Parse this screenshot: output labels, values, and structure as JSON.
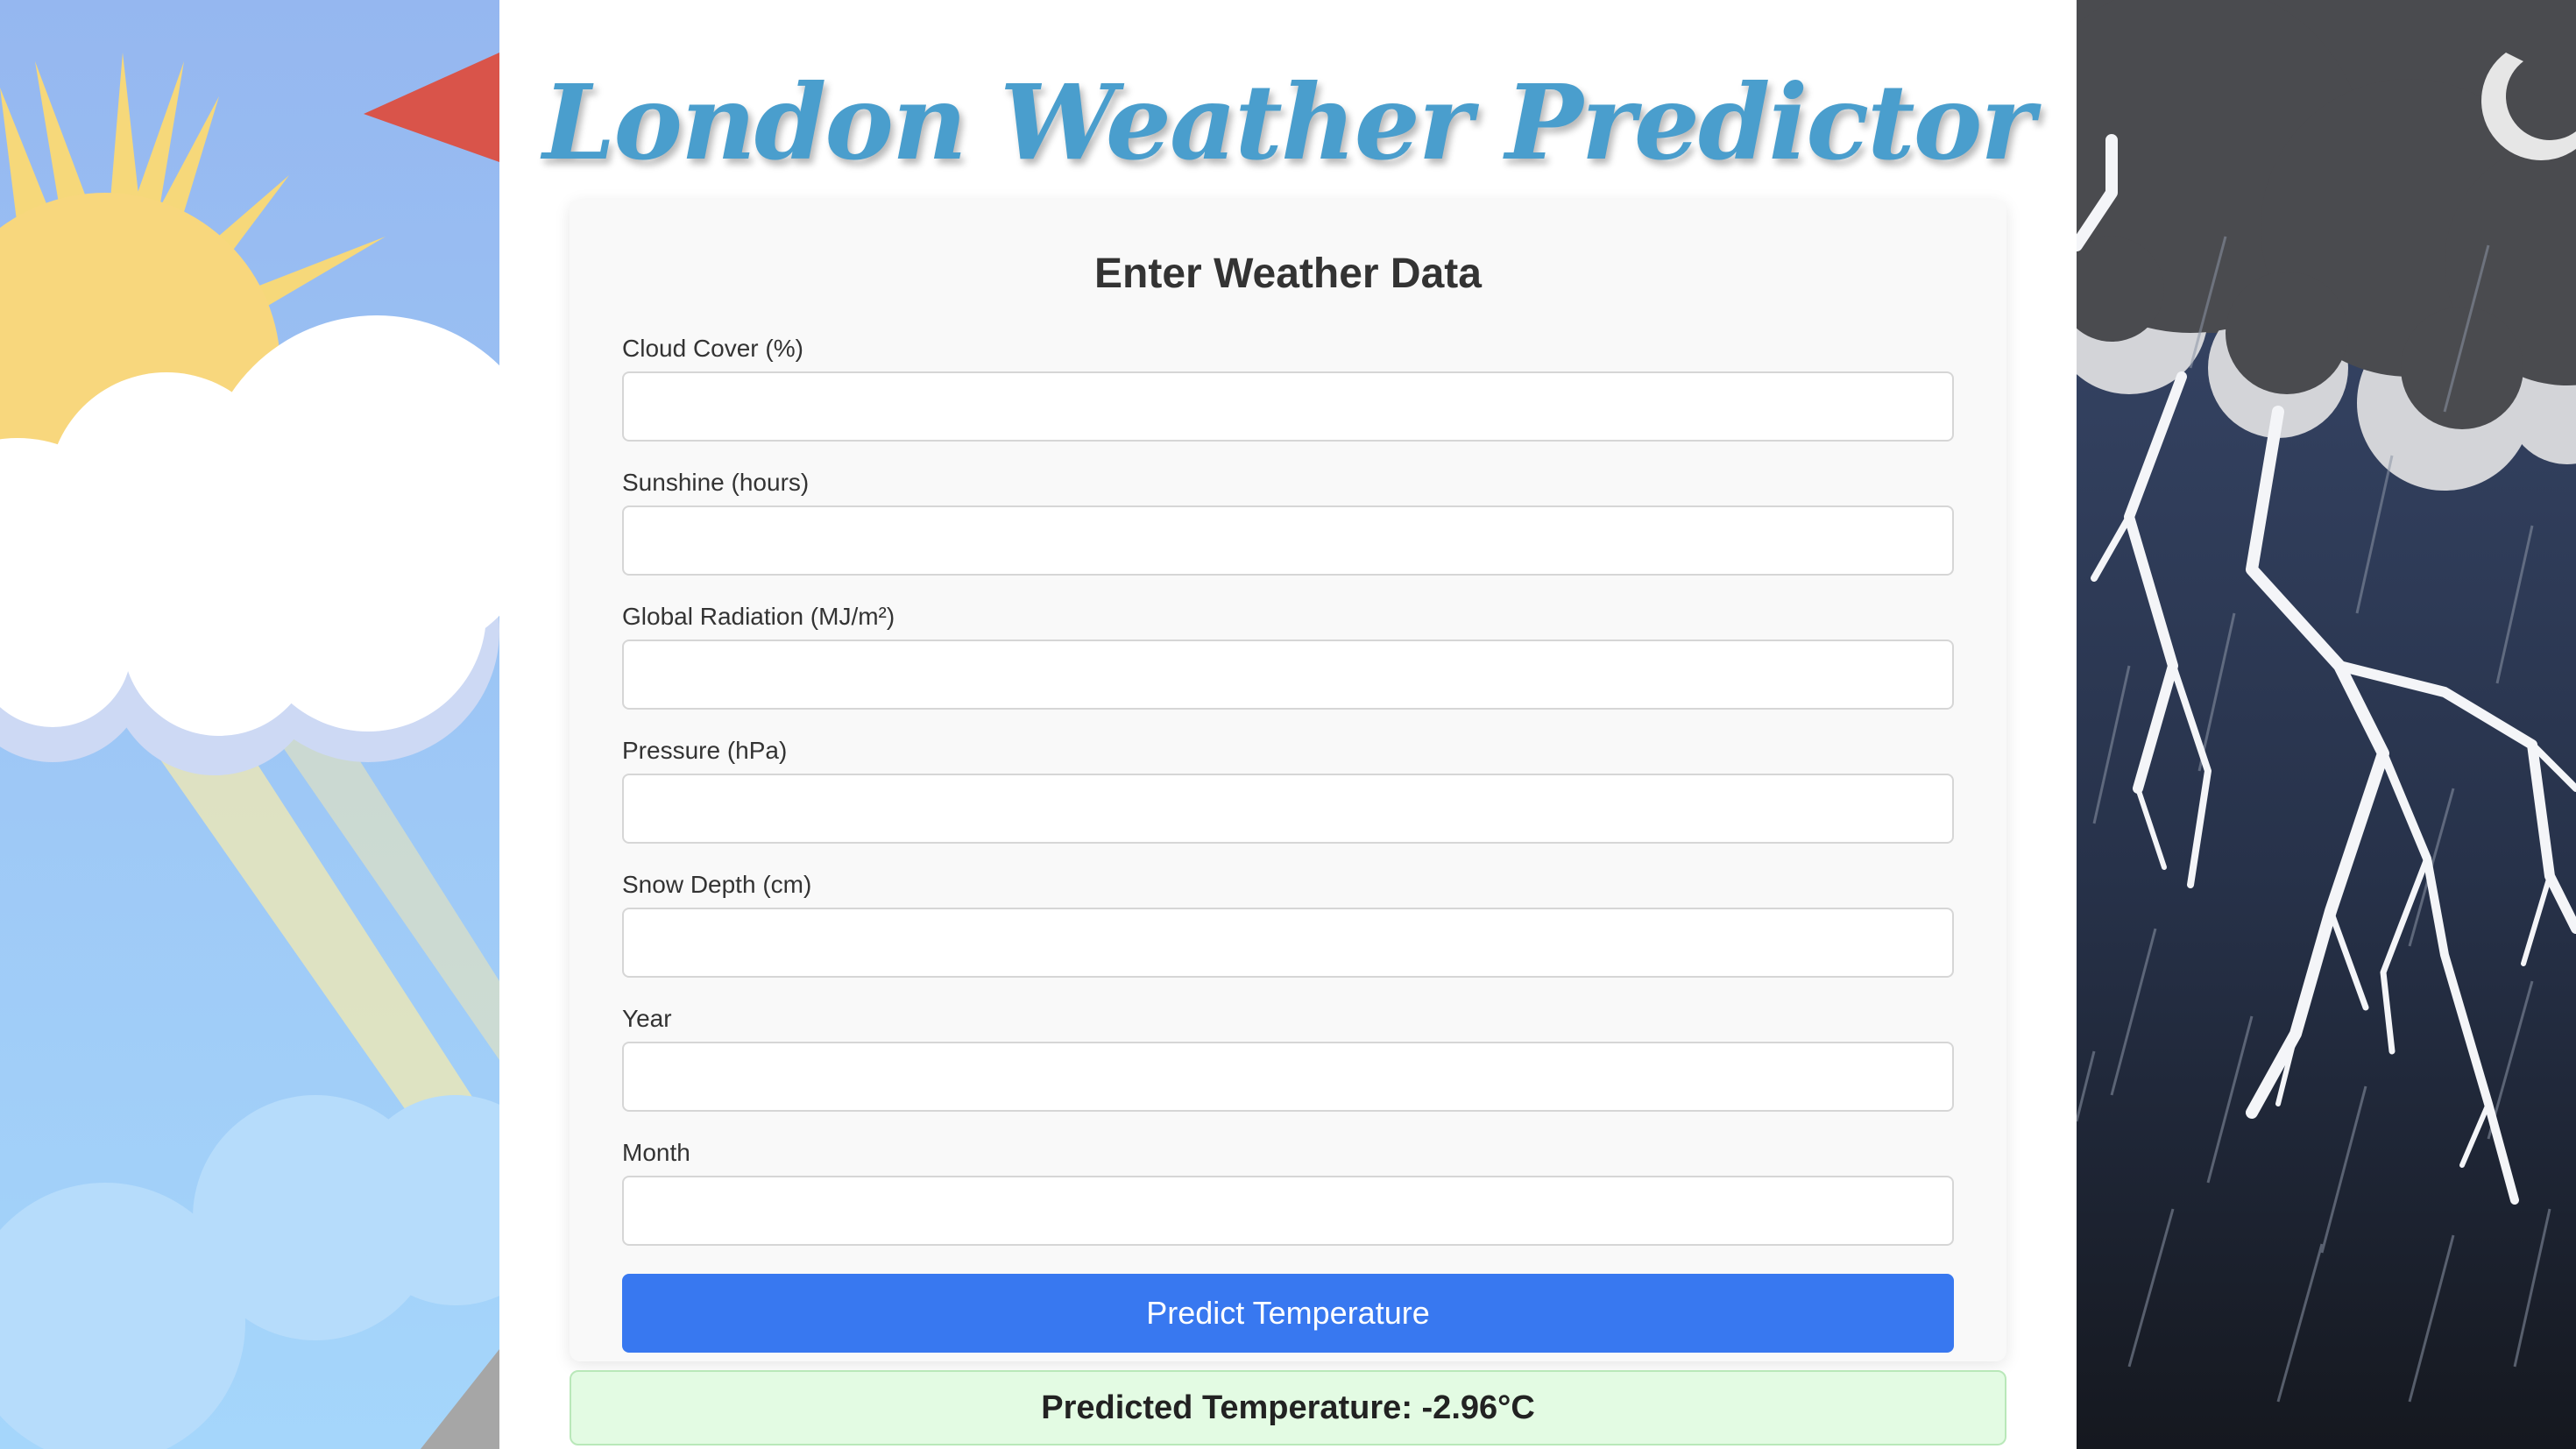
{
  "app": {
    "title": "London Weather Predictor"
  },
  "form": {
    "heading": "Enter Weather Data",
    "fields": [
      {
        "label": "Cloud Cover (%)",
        "value": "",
        "placeholder": ""
      },
      {
        "label": "Sunshine (hours)",
        "value": "",
        "placeholder": ""
      },
      {
        "label": "Global Radiation (MJ/m²)",
        "value": "",
        "placeholder": ""
      },
      {
        "label": "Pressure (hPa)",
        "value": "",
        "placeholder": ""
      },
      {
        "label": "Snow Depth (cm)",
        "value": "",
        "placeholder": ""
      },
      {
        "label": "Year",
        "value": "",
        "placeholder": ""
      },
      {
        "label": "Month",
        "value": "",
        "placeholder": ""
      }
    ],
    "submit_label": "Predict Temperature"
  },
  "result": {
    "text": "Predicted Temperature: -2.96°C"
  },
  "colors": {
    "title": "#4a9ecd",
    "button": "#3878f0",
    "result_bg": "#e3fbe3",
    "sunny_sky": "#a6d3f5",
    "storm_sky": "#2a3548"
  },
  "decorations": {
    "left_panel": "sunny-weather-illustration",
    "right_panel": "thunderstorm-illustration"
  }
}
